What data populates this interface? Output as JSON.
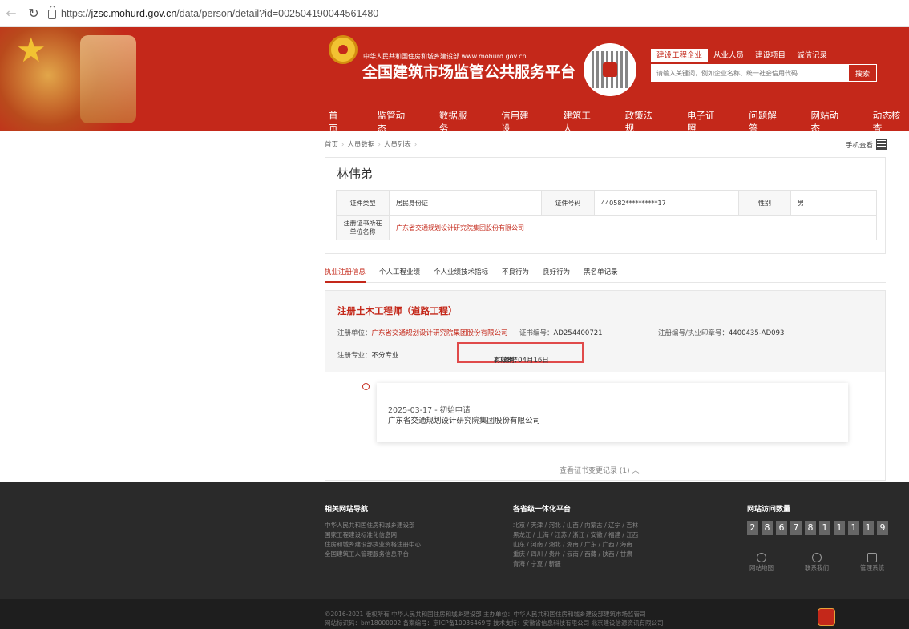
{
  "browser": {
    "url_prefix": "https://",
    "url_host": "jzsc.mohurd.gov.cn",
    "url_path": "/data/person/detail?id=002504190044561480"
  },
  "header": {
    "ministry_line": "中华人民共和国住房和城乡建设部  www.mohurd.gov.cn",
    "site_title": "全国建筑市场监管公共服务平台",
    "search_tabs": [
      "建设工程企业",
      "从业人员",
      "建设项目",
      "诚信记录"
    ],
    "search_placeholder": "请输入关键词，例如企业名称、统一社会信用代码",
    "search_button": "搜索",
    "nav": [
      "首页",
      "监管动态",
      "数据服务",
      "信用建设",
      "建筑工人",
      "政策法规",
      "电子证照",
      "问题解答",
      "网站动态",
      "动态核查"
    ]
  },
  "breadcrumb": [
    "首页",
    "人员数据",
    "人员列表"
  ],
  "mobile_view": "手机查看",
  "person": {
    "name": "林伟弟",
    "id_type_label": "证件类型",
    "id_type": "居民身份证",
    "id_no_label": "证件号码",
    "id_no": "440582**********17",
    "gender_label": "性别",
    "gender": "男",
    "company_label": "注册证书所在单位名称",
    "company": "广东省交通规划设计研究院集团股份有限公司"
  },
  "tabs": [
    "执业注册信息",
    "个人工程业绩",
    "个人业绩技术指标",
    "不良行为",
    "良好行为",
    "黑名单记录"
  ],
  "registration": {
    "title": "注册土木工程师（道路工程）",
    "unit_label": "注册单位：",
    "unit": "广东省交通规划设计研究院集团股份有限公司",
    "cert_label": "证书编号：",
    "cert_no": "AD254400721",
    "regno_label": "注册编号/执业印章号：",
    "regno": "4400435-AD093",
    "major_label": "注册专业：",
    "major": "不分专业",
    "validity_label": "有效期：",
    "validity": "2028年04月16日"
  },
  "timeline": {
    "date_event": "2025-03-17 - 初始申请",
    "company": "广东省交通规划设计研究院集团股份有限公司",
    "more": "查看证书变更记录 (1)  ︿"
  },
  "footer": {
    "nav_title": "相关网站导航",
    "nav_links": [
      "中华人民共和国住房和城乡建设部",
      "国家工程建设标准化信息网",
      "住房和城乡建设部执业资格注册中心",
      "全国建筑工人管理服务信息平台"
    ],
    "prov_title": "各省级一体化平台",
    "prov_lines": [
      "北京 / 天津 / 河北 / 山西 / 内蒙古 / 辽宁 / 吉林",
      "黑龙江 / 上海 / 江苏 / 浙江 / 安徽 / 福建 / 江西",
      "山东 / 河南 / 湖北 / 湖南 / 广东 / 广西 / 海南",
      "重庆 / 四川 / 贵州 / 云南 / 西藏 / 陕西 / 甘肃",
      "青海 / 宁夏 / 新疆"
    ],
    "visit_title": "网站访问数量",
    "visit_digits": [
      "2",
      "8",
      "6",
      "7",
      "8",
      "1",
      "1",
      "1",
      "1",
      "9"
    ],
    "icons": [
      "网站地图",
      "联系我们",
      "管理系统"
    ],
    "copyright1": "©2016-2021 版权所有 中华人民共和国住房和城乡建设部   主办单位：中华人民共和国住房和城乡建设部建筑市场监管司",
    "copyright2": "网站标识码：bm18000002   备案编号：京ICP备10036469号   技术支持：安徽省信息科技有限公司 北京建设信源资讯有限公司"
  }
}
